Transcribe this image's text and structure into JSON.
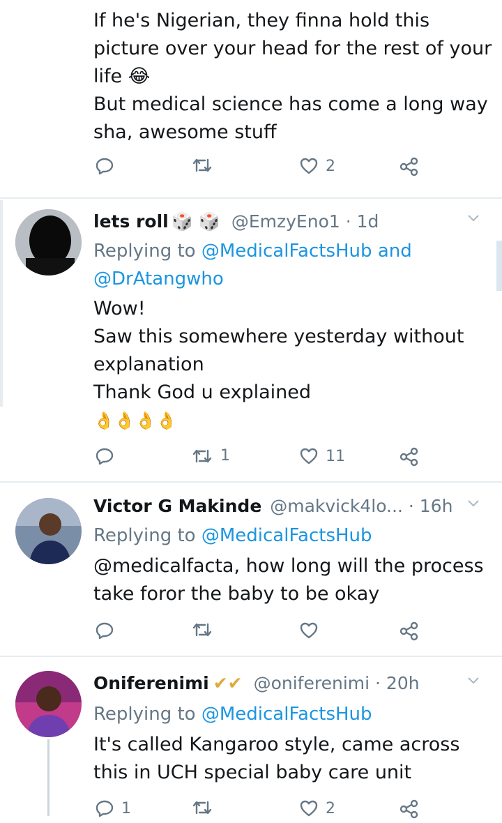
{
  "tweets": [
    {
      "body_lines": [
        "If he's Nigerian, they finna hold this",
        "picture over your head for the rest of your",
        "life 😂",
        "But medical science has come a long way",
        "sha, awesome stuff"
      ],
      "actions": {
        "reply_count": "",
        "retweet_count": "",
        "like_count": "2"
      }
    },
    {
      "name": "lets roll",
      "name_emoji": "🎲 🎲",
      "handle": "@EmzyEno1",
      "separator": "·",
      "time": "1d",
      "replying_prefix": "Replying to",
      "replying_to_1": "@MedicalFactsHub",
      "replying_and": "and",
      "replying_to_2": "@DrAtangwho",
      "body_lines": [
        "Wow!",
        "Saw this somewhere yesterday without",
        "explanation",
        "Thank God u explained",
        "👌👌👌👌"
      ],
      "actions": {
        "reply_count": "",
        "retweet_count": "1",
        "like_count": "11"
      }
    },
    {
      "name": "Victor G Makinde",
      "handle": "@makvick4lo...",
      "separator": "·",
      "time": "16h",
      "replying_prefix": "Replying to",
      "replying_to_1": "@MedicalFactsHub",
      "body_lines": [
        "@medicalfacta, how long will the process",
        "take foror the baby to be okay"
      ],
      "actions": {
        "reply_count": "",
        "retweet_count": "",
        "like_count": ""
      }
    },
    {
      "name": "Oniferenimi",
      "name_emoji": "✔✔",
      "handle": "@oniferenimi",
      "separator": "·",
      "time": "20h",
      "replying_prefix": "Replying to",
      "replying_to_1": "@MedicalFactsHub",
      "body_lines": [
        "It's called Kangaroo style, came across",
        "this in UCH special baby care unit"
      ],
      "actions": {
        "reply_count": "1",
        "retweet_count": "",
        "like_count": "2"
      }
    }
  ],
  "colors": {
    "link": "#1b95e0",
    "muted": "#657786",
    "divider": "#e6ecf0"
  }
}
